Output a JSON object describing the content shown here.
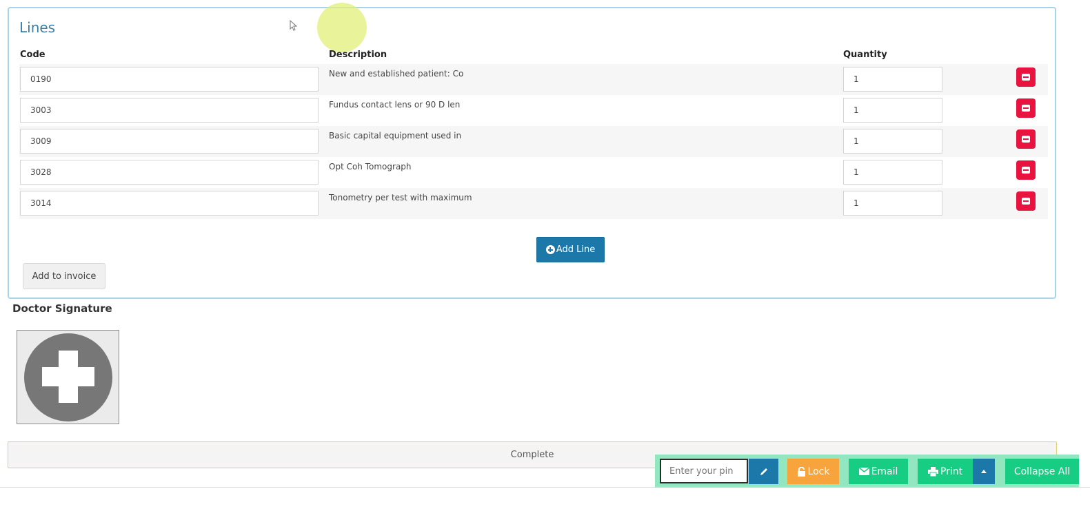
{
  "lines": {
    "title": "Lines",
    "columns": {
      "code": "Code",
      "description": "Description",
      "quantity": "Quantity"
    },
    "rows": [
      {
        "code": "0190",
        "description": "New and established patient: Co",
        "quantity": "1"
      },
      {
        "code": "3003",
        "description": "Fundus contact lens or 90 D len",
        "quantity": "1"
      },
      {
        "code": "3009",
        "description": "Basic capital equipment used in",
        "quantity": "1"
      },
      {
        "code": "3028",
        "description": "Opt Coh Tomograph",
        "quantity": "1"
      },
      {
        "code": "3014",
        "description": "Tonometry per test with maximum",
        "quantity": "1"
      }
    ],
    "add_line_label": "Add Line",
    "add_to_invoice_label": "Add to invoice"
  },
  "signature": {
    "label": "Doctor Signature"
  },
  "complete_label": "Complete",
  "toolbar": {
    "pin_placeholder": "Enter your pin",
    "lock_label": "Lock",
    "email_label": "Email",
    "print_label": "Print",
    "collapse_label": "Collapse All"
  },
  "colors": {
    "accent_blue": "#1b78a8",
    "remove_red": "#e8133f",
    "success_green": "#17cd83",
    "lock_orange": "#f7a43c"
  }
}
